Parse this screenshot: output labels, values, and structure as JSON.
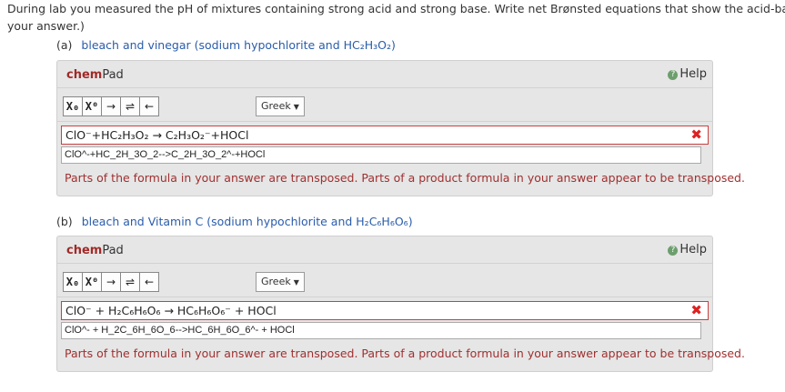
{
  "intro": {
    "line1": "During lab you measured the pH of mixtures containing strong acid and strong base. Write net Brønsted equations that show the acid-base reac",
    "line2": "your answer.)"
  },
  "parts": [
    {
      "letter": "(a)",
      "prompt": "bleach and vinegar (sodium hypochlorite and HC₂H₃O₂)",
      "chempad": {
        "title_chem": "chem",
        "title_pad": "Pad",
        "help": "Help",
        "toolbar": {
          "sub": "X₀",
          "sup": "X⁰",
          "arrow": "→",
          "equilibrium": "⇌",
          "backspace": "←",
          "greek": "Greek"
        },
        "formula": "ClO⁻+HC₂H₃O₂ → C₂H₃O₂⁻+HOCl",
        "raw": "ClO^-+HC_2H_3O_2-->C_2H_3O_2^-+HOCl",
        "feedback": "Parts of the formula in your answer are transposed. Parts of a product formula in your answer appear to be transposed.",
        "wrong_icon": "x-icon"
      }
    },
    {
      "letter": "(b)",
      "prompt": "bleach and Vitamin C (sodium hypochlorite and H₂C₆H₆O₆)",
      "chempad": {
        "title_chem": "chem",
        "title_pad": "Pad",
        "help": "Help",
        "toolbar": {
          "sub": "X₀",
          "sup": "X⁰",
          "arrow": "→",
          "equilibrium": "⇌",
          "backspace": "←",
          "greek": "Greek"
        },
        "formula": "ClO⁻ + H₂C₆H₆O₆ → HC₆H₆O₆⁻ + HOCl",
        "raw": "ClO^- + H_2C_6H_6O_6-->HC_6H_6O_6^- + HOCl",
        "feedback": "Parts of the formula in your answer are transposed. Parts of a product formula in your answer appear to be transposed.",
        "wrong_icon": "x-icon"
      }
    }
  ],
  "colors": {
    "link": "#2a5caa",
    "error": "#a03030",
    "x_mark": "#d22222",
    "panel": "#e6e6e6"
  }
}
